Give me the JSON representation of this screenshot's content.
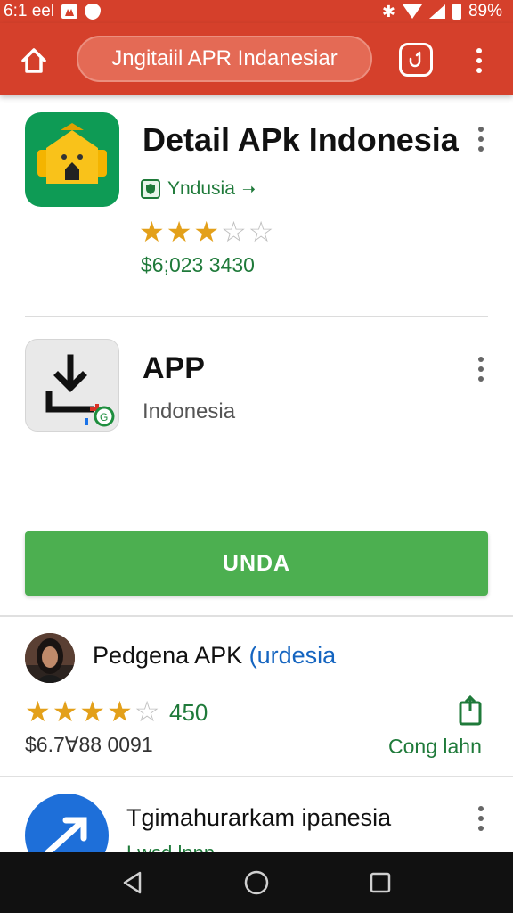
{
  "status_bar": {
    "time": "6:1 eel",
    "battery": "89%"
  },
  "app_bar": {
    "search_text": "Jngitaiil APR Indanesiar"
  },
  "card1": {
    "title": "Detail APk Indonesia",
    "verified_label": "Yndusia",
    "rating": 3,
    "rating_max": 5,
    "price": "$6;023 3430"
  },
  "card2": {
    "title": "APP",
    "subtitle": "Indonesia"
  },
  "install_button": {
    "label": "UNDA"
  },
  "review": {
    "title_main": "Pedgena APK ",
    "title_link": "(urdesia",
    "rating": 4,
    "rating_max": 5,
    "count": "450",
    "price": "$6.7∀88 0091",
    "share_label": "Cong lahn"
  },
  "row4": {
    "title": "Tgimahurarkam ipanesia",
    "subtitle": "Lwsd lnnn"
  },
  "colors": {
    "accent_red": "#d5402b",
    "accent_green": "#4caf50",
    "text_green": "#1f7a3a",
    "star_gold": "#e3a01a",
    "link_blue": "#1565c0"
  },
  "icons": [
    "home-icon",
    "hook-icon",
    "more-vert-icon",
    "verified-shield-icon",
    "download-icon",
    "share-icon",
    "back-icon",
    "home-circle-icon",
    "recents-icon"
  ]
}
